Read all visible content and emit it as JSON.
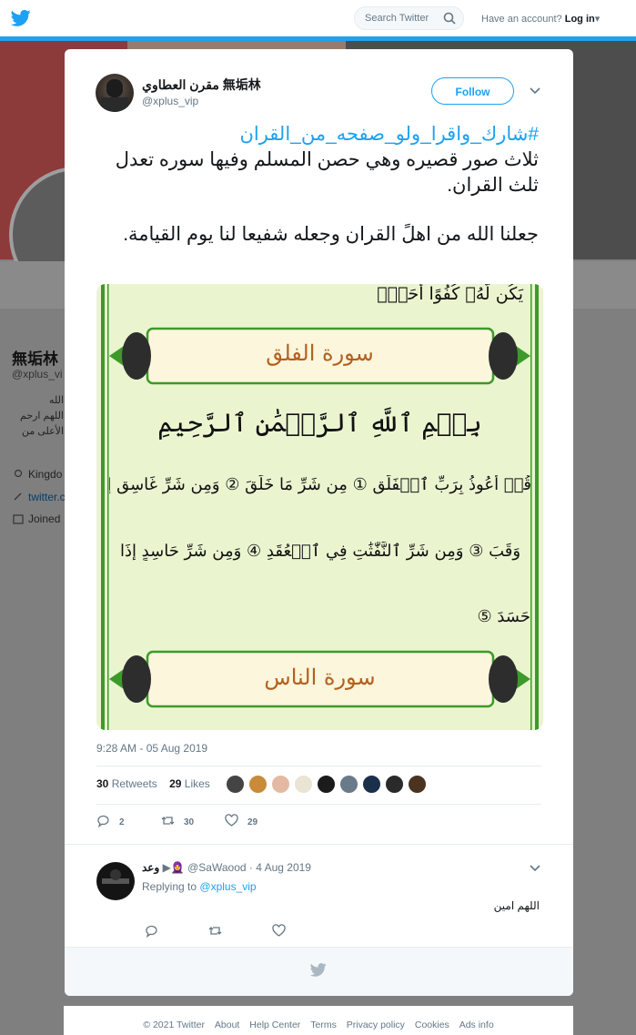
{
  "topbar": {
    "search_placeholder": "Search Twitter",
    "have_account": "Have an account?",
    "login": "Log in"
  },
  "profile_bg": {
    "name": "無垢林",
    "handle": "@xplus_vi",
    "bio_lines": [
      "الله",
      "اللهم ارحم",
      "الأعلى من"
    ],
    "location": "Kingdo",
    "website": "twitter.c",
    "joined": "Joined"
  },
  "tweet": {
    "author_name": "مقرن العطاوي 無垢林",
    "author_handle": "@xplus_vip",
    "follow_label": "Follow",
    "hashtag": "#شارك_واقرا_ولو_صفحه_من_القران",
    "line1": "ثلاث صور قصيره وهي حصن المسلم  وفيها سوره تعدل ثلث القران.",
    "line2": "جعلنا الله من اهلً القران وجعله شفيعا لنا يوم القيامة.",
    "timestamp": "9:28 AM - 05 Aug 2019",
    "retweets_count": "30",
    "retweets_label": "Retweets",
    "likes_count": "29",
    "likes_label": "Likes",
    "reply_count": "2",
    "retweet_action_count": "30",
    "like_action_count": "29",
    "media": {
      "top_line": "يَكُن لَّهُۥ كُفُوًا أَحَدُۢ",
      "top_ayah": "4",
      "surah1": "سورة الفلق",
      "basmala": "بِسۡمِ ٱللَّهِ ٱلرَّحۡمَٰنِ ٱلرَّحِيمِ",
      "verse_line1": "قُلۡ أَعُوذُ بِرَبِّ ٱلۡفَلَقِ ① مِن شَرِّ مَا خَلَقَ ② وَمِن شَرِّ غَاسِقٍ إِذَا",
      "verse_line2": "وَقَبَ ③ وَمِن شَرِّ ٱلنَّفَّٰثَٰتِ فِي ٱلۡعُقَدِ ④ وَمِن شَرِّ حَاسِدٍ إِذَا",
      "verse_line3": "حَسَدَ ⑤",
      "surah2": "سورة الناس"
    }
  },
  "reply": {
    "name": "وعد",
    "handle": "@SaWaood",
    "date": "· 4 Aug 2019",
    "replying_to": "Replying to",
    "replying_handle": "@xplus_vip",
    "text": "اللهم امين"
  },
  "footer": {
    "links": [
      "© 2021 Twitter",
      "About",
      "Help Center",
      "Terms",
      "Privacy policy",
      "Cookies",
      "Ads info"
    ]
  },
  "colors": {
    "accent": "#1da1f2",
    "page_overlay": "#7f7f7f",
    "surah_frame_green": "#3d9a2a"
  }
}
